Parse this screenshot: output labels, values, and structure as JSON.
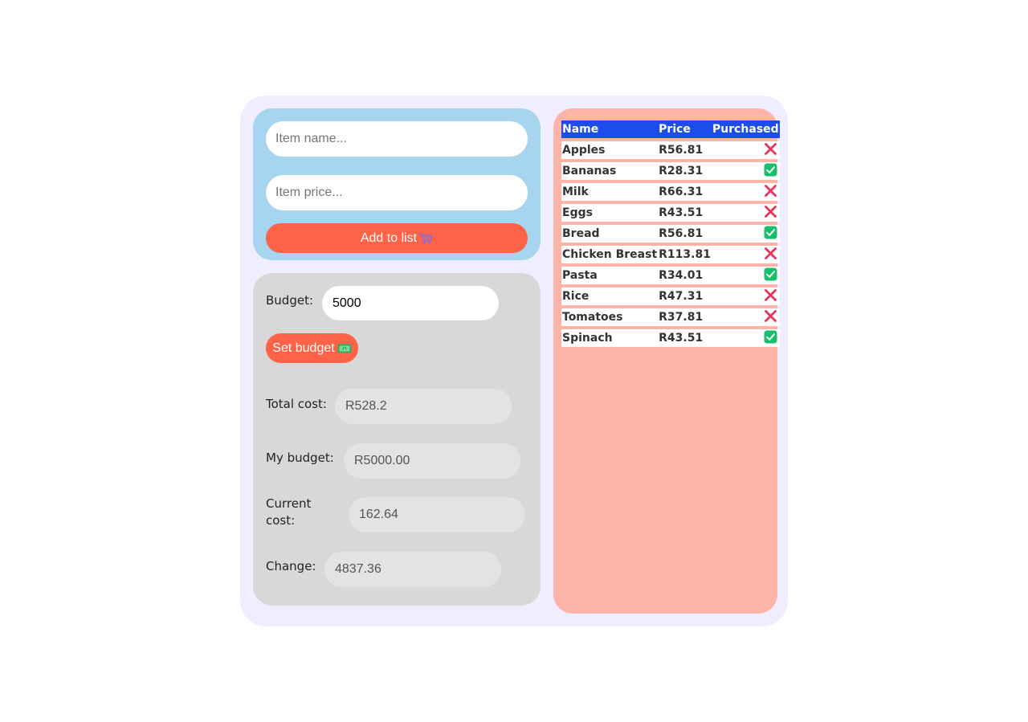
{
  "add_form": {
    "name_placeholder": "Item name...",
    "price_placeholder": "Item price...",
    "add_button_label": "Add to list"
  },
  "budget_panel": {
    "budget_label": "Budget:",
    "budget_value": "5000",
    "set_button_label": "Set budget",
    "total_cost_label": "Total cost:",
    "total_cost_value": "R528.2",
    "my_budget_label": "My budget:",
    "my_budget_value": "R5000.00",
    "current_cost_label_1": "Current",
    "current_cost_label_2": "cost:",
    "current_cost_value": "162.64",
    "change_label": "Change:",
    "change_value": "4837.36"
  },
  "shopping_list": {
    "columns": [
      "Name",
      "Price",
      "Purchased"
    ],
    "rows": [
      {
        "name": "Apples",
        "price": "R56.81",
        "purchased": false
      },
      {
        "name": "Bananas",
        "price": "R28.31",
        "purchased": true
      },
      {
        "name": "Milk",
        "price": "R66.31",
        "purchased": false
      },
      {
        "name": "Eggs",
        "price": "R43.51",
        "purchased": false
      },
      {
        "name": "Bread",
        "price": "R56.81",
        "purchased": true
      },
      {
        "name": "Chicken Breast",
        "price": "R113.81",
        "purchased": false
      },
      {
        "name": "Pasta",
        "price": "R34.01",
        "purchased": true
      },
      {
        "name": "Rice",
        "price": "R47.31",
        "purchased": false
      },
      {
        "name": "Tomatoes",
        "price": "R37.81",
        "purchased": false
      },
      {
        "name": "Spinach",
        "price": "R43.51",
        "purchased": true
      }
    ]
  },
  "icons": {
    "add_button_icon": "shopping-cart-icon",
    "set_button_icon": "money-icon",
    "purchased_true_icon": "check-icon",
    "purchased_false_icon": "x-icon"
  },
  "colors": {
    "accent": "#fe6347",
    "table_header": "#1d4de8",
    "check_green": "#14c06a",
    "x_red": "#e8325f",
    "add_card": "#a7d4ef",
    "list_card": "#fdb4a8"
  }
}
